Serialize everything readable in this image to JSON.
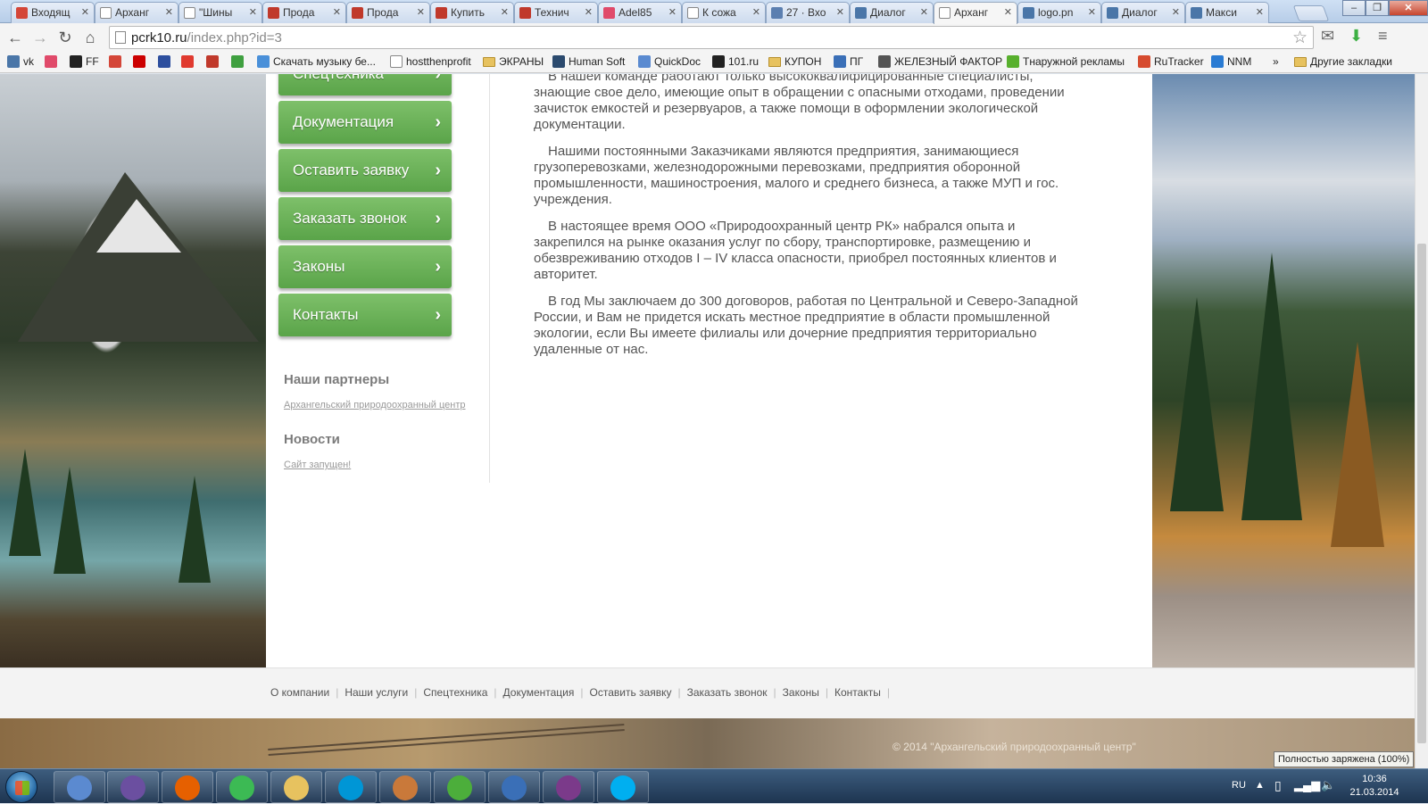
{
  "browser": {
    "tabs": [
      {
        "label": "Входящ",
        "icon": "gmail-icon",
        "color": "#d44638"
      },
      {
        "label": "Арханг",
        "icon": "page-icon",
        "color": "#ffffff"
      },
      {
        "label": "\"Шины",
        "icon": "page-icon",
        "color": "#ffffff"
      },
      {
        "label": "Прода",
        "icon": "avito-icon",
        "color": "#c0392b"
      },
      {
        "label": "Прода",
        "icon": "avito-icon",
        "color": "#c0392b"
      },
      {
        "label": "Купить",
        "icon": "avito-icon",
        "color": "#c0392b"
      },
      {
        "label": "Технич",
        "icon": "avito-icon",
        "color": "#c0392b"
      },
      {
        "label": "Adel85",
        "icon": "love-icon",
        "color": "#e04a6a"
      },
      {
        "label": "К сожа",
        "icon": "page-icon",
        "color": "#ffffff"
      },
      {
        "label": "27 · Вхо",
        "icon": "mail-icon",
        "color": "#5b7fb0"
      },
      {
        "label": "Диалог",
        "icon": "chat-icon",
        "color": "#4a76a8"
      },
      {
        "label": "Арханг",
        "icon": "page-icon",
        "color": "#ffffff",
        "active": true
      },
      {
        "label": "logo.pn",
        "icon": "vk-icon",
        "color": "#4a76a8"
      },
      {
        "label": "Диалог",
        "icon": "chat-icon",
        "color": "#4a76a8"
      },
      {
        "label": "Макси",
        "icon": "vk-icon",
        "color": "#4a76a8"
      }
    ],
    "url_host": "pcrk10.ru",
    "url_path": "/index.php?id=3",
    "bookmarks": [
      {
        "label": "vk",
        "icon": "vk-icon",
        "color": "#4a76a8"
      },
      {
        "label": "",
        "icon": "love-icon",
        "color": "#e04a6a"
      },
      {
        "label": "FF",
        "icon": "ff-icon",
        "color": "#222222"
      },
      {
        "label": "",
        "icon": "gmail-icon",
        "color": "#d44638"
      },
      {
        "label": "",
        "icon": "youtube-icon",
        "color": "#cc0000"
      },
      {
        "label": "",
        "icon": "f-icon",
        "color": "#2d4f9e"
      },
      {
        "label": "",
        "icon": "yandex-icon",
        "color": "#e03a2f"
      },
      {
        "label": "",
        "icon": "stats-icon",
        "color": "#c0392b"
      },
      {
        "label": "",
        "icon": "circle-icon",
        "color": "#3fa040"
      },
      {
        "label": "Скачать музыку бе...",
        "icon": "music-icon",
        "color": "#4a90d9"
      },
      {
        "label": "hostthenprofit",
        "icon": "page-icon",
        "color": "#ffffff"
      },
      {
        "label": "ЭКРАНЫ",
        "icon": "folder-icon",
        "color": "#e7c25f"
      },
      {
        "label": "Human Soft",
        "icon": "hs-icon",
        "color": "#2b4a6e"
      },
      {
        "label": "QuickDoc",
        "icon": "quickdoc-icon",
        "color": "#5a8ad0"
      },
      {
        "label": "101.ru",
        "icon": "play-icon",
        "color": "#222222"
      },
      {
        "label": "КУПОН",
        "icon": "folder-icon",
        "color": "#e7c25f"
      },
      {
        "label": "ПГ",
        "icon": "pg-icon",
        "color": "#3a6fb7"
      },
      {
        "label": "ЖЕЛЕЗНЫЙ ФАКТОР",
        "icon": "robot-icon",
        "color": "#555555"
      },
      {
        "label": "Тнаружной рекламы",
        "icon": "leaf-icon",
        "color": "#58b02e"
      },
      {
        "label": "RuTracker",
        "icon": "rutracker-icon",
        "color": "#d64b2f"
      },
      {
        "label": "NNM",
        "icon": "nnm-icon",
        "color": "#2a7bd3"
      }
    ],
    "bookmarks_more": "»",
    "other_bookmarks": "Другие закладки"
  },
  "sidebar": {
    "menu": [
      {
        "label": "Спецтехника"
      },
      {
        "label": "Документация"
      },
      {
        "label": "Оставить заявку"
      },
      {
        "label": "Заказать звонок"
      },
      {
        "label": "Законы"
      },
      {
        "label": "Контакты"
      }
    ],
    "partners_heading": "Наши партнеры",
    "partners_link": "Архангельский природоохранный центр",
    "news_heading": "Новости",
    "news_link": "Сайт запущен!"
  },
  "article": {
    "paragraphs": [
      "В нашей команде работают только высококвалифицированные специалисты, знающие свое дело, имеющие опыт в обращении с опасными отходами, проведении зачисток емкостей и резервуаров, а также помощи в оформлении экологической документации.",
      "Нашими постоянными Заказчиками являются предприятия, занимающиеся грузоперевозками, железнодорожными перевозками, предприятия оборонной промышленности, машиностроения, малого и среднего бизнеса, а также МУП и гос. учреждения.",
      "В настоящее время ООО «Природоохранный центр РК» набрался опыта и закрепился на рынке оказания услуг по сбору, транспортировке, размещению и обезвреживанию отходов I – IV класса опасности, приобрел постоянных клиентов и авторитет.",
      "В год Мы заключаем до 300 договоров, работая по Центральной и Северо-Западной России, и Вам не придется искать местное предприятие в области промышленной экологии, если Вы имеете филиалы или дочерние предприятия территориально удаленные от нас."
    ]
  },
  "footer": {
    "links": [
      "О компании",
      "Наши услуги",
      "Спецтехника",
      "Документация",
      "Оставить заявку",
      "Заказать звонок",
      "Законы",
      "Контакты"
    ],
    "separator": "|",
    "copyright": "© 2014 \"Архангельский природоохранный центр\""
  },
  "tooltip": "Полностью заряжена (100%)",
  "taskbar": {
    "apps": [
      {
        "name": "notepad",
        "color": "#5b8ad0"
      },
      {
        "name": "visual-studio",
        "color": "#6b4fa0"
      },
      {
        "name": "firefox",
        "color": "#e66000"
      },
      {
        "name": "chrome",
        "color": "#3cba54"
      },
      {
        "name": "explorer",
        "color": "#e7c25f"
      },
      {
        "name": "hp",
        "color": "#0096d6"
      },
      {
        "name": "presentation",
        "color": "#c9793a"
      },
      {
        "name": "utorrent",
        "color": "#4cae3b"
      },
      {
        "name": "security",
        "color": "#3a6fb7"
      },
      {
        "name": "winrar",
        "color": "#7b3a8a"
      },
      {
        "name": "skype",
        "color": "#00aff0"
      }
    ],
    "language": "RU",
    "time": "10:36",
    "date": "21.03.2014"
  }
}
